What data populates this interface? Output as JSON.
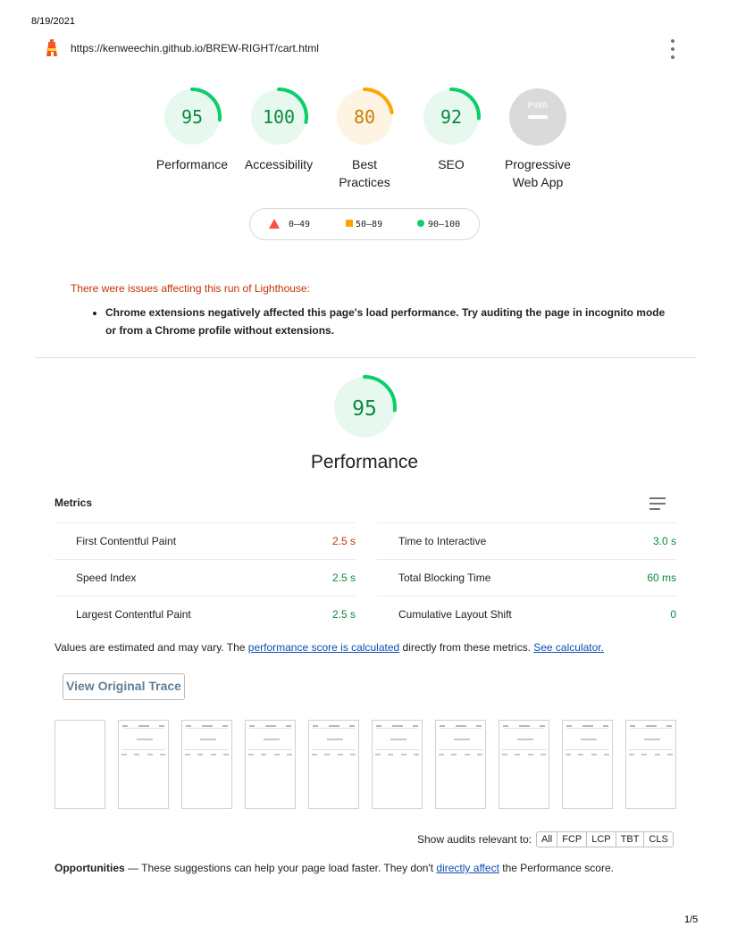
{
  "header": {
    "date": "8/19/2021",
    "url": "https://kenweechin.github.io/BREW-RIGHT/cart.html",
    "logo_icon": "lighthouse-icon",
    "menu_icon": "more-vert-icon"
  },
  "gauges": [
    {
      "score": "95",
      "value": 0.95,
      "label_lines": [
        "Performance",
        ""
      ],
      "color": "#0cce6b",
      "bg": "#e7f9ef"
    },
    {
      "score": "100",
      "value": 1.0,
      "label_lines": [
        "Accessibility",
        ""
      ],
      "color": "#0cce6b",
      "bg": "#e7f9ef"
    },
    {
      "score": "80",
      "value": 0.8,
      "label_lines": [
        "Best",
        "Practices"
      ],
      "color": "#ffa400",
      "bg": "#fff4e3"
    },
    {
      "score": "92",
      "value": 0.92,
      "label_lines": [
        "SEO",
        ""
      ],
      "color": "#0cce6b",
      "bg": "#e7f9ef"
    }
  ],
  "pwa": {
    "badge": "PWA",
    "label_lines": [
      "Progressive",
      "Web App"
    ]
  },
  "legend": {
    "fail": "0–49",
    "average": "50–89",
    "pass": "90–100"
  },
  "warnings": {
    "title": "There were issues affecting this run of Lighthouse:",
    "items": [
      "Chrome extensions negatively affected this page's load performance. Try auditing the page in incognito mode or from a Chrome profile without extensions."
    ]
  },
  "performance": {
    "score": "95",
    "value": 0.95,
    "title": "Performance",
    "metrics_title": "Metrics",
    "metrics": [
      {
        "name": "First Contentful Paint",
        "value": "2.5 s",
        "status": "avg"
      },
      {
        "name": "Time to Interactive",
        "value": "3.0 s",
        "status": "good"
      },
      {
        "name": "Speed Index",
        "value": "2.5 s",
        "status": "good"
      },
      {
        "name": "Total Blocking Time",
        "value": "60 ms",
        "status": "good"
      },
      {
        "name": "Largest Contentful Paint",
        "value": "2.5 s",
        "status": "good"
      },
      {
        "name": "Cumulative Layout Shift",
        "value": "0",
        "status": "good"
      }
    ],
    "note": {
      "pre": "Values are estimated and may vary. The ",
      "link1": "performance score is calculated",
      "mid": " directly from these metrics. ",
      "link2": "See calculator."
    },
    "trace_button": "View Original Trace",
    "filmstrip_count": 10,
    "filter_label": "Show audits relevant to:",
    "filters": [
      "All",
      "FCP",
      "LCP",
      "TBT",
      "CLS"
    ],
    "opportunities": {
      "title": "Opportunities",
      "dash": " — ",
      "pre": "These suggestions can help your page load faster. They don't ",
      "link": "directly affect",
      "post": " the Performance score."
    }
  },
  "footer": {
    "page": "1/5"
  }
}
